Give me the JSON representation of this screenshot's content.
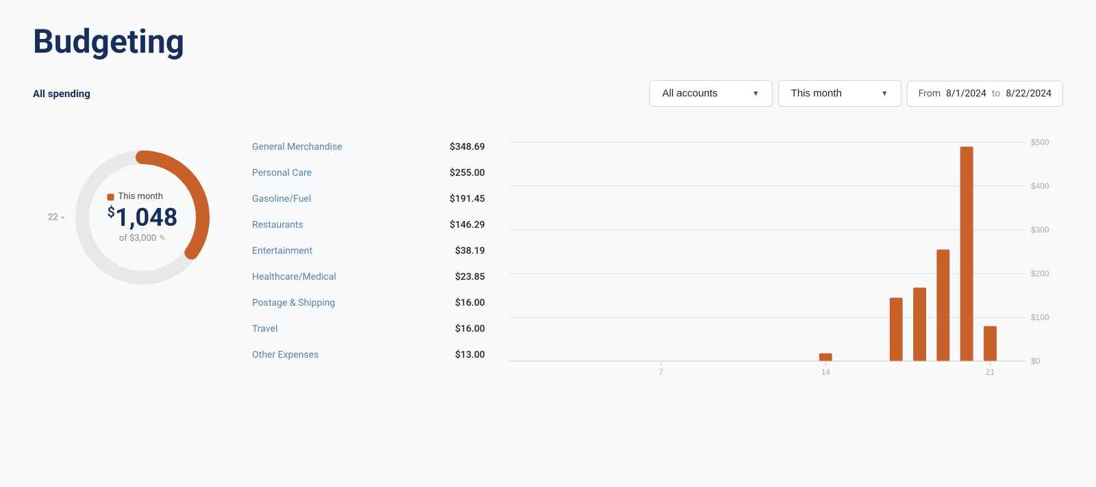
{
  "page": {
    "title": "Budgeting"
  },
  "controls": {
    "all_spending_label": "All spending",
    "accounts_dropdown_label": "All accounts",
    "period_dropdown_label": "This month",
    "from_label": "From",
    "from_date": "8/1/2024",
    "to_label": "to",
    "to_date": "8/22/2024"
  },
  "donut": {
    "legend_label": "This month",
    "amount_symbol": "$",
    "amount": "1,048",
    "of_label": "of $3,000",
    "tick_label": "22",
    "progress_pct": 34.93,
    "color": "#c8602a",
    "track_color": "#e8e8e8"
  },
  "spending_categories": [
    {
      "name": "General Merchandise",
      "amount": "$348.69"
    },
    {
      "name": "Personal Care",
      "amount": "$255.00"
    },
    {
      "name": "Gasoline/Fuel",
      "amount": "$191.45"
    },
    {
      "name": "Restaurants",
      "amount": "$146.29"
    },
    {
      "name": "Entertainment",
      "amount": "$38.19"
    },
    {
      "name": "Healthcare/Medical",
      "amount": "$23.85"
    },
    {
      "name": "Postage & Shipping",
      "amount": "$16.00"
    },
    {
      "name": "Travel",
      "amount": "$16.00"
    },
    {
      "name": "Other Expenses",
      "amount": "$13.00"
    }
  ],
  "bar_chart": {
    "y_labels": [
      "$500",
      "$400",
      "$300",
      "$200",
      "$100",
      "$0"
    ],
    "x_labels": [
      "7",
      "14",
      "21"
    ],
    "bars": [
      {
        "day": 1,
        "value": 0
      },
      {
        "day": 2,
        "value": 0
      },
      {
        "day": 3,
        "value": 0
      },
      {
        "day": 4,
        "value": 0
      },
      {
        "day": 5,
        "value": 0
      },
      {
        "day": 6,
        "value": 0
      },
      {
        "day": 7,
        "value": 0
      },
      {
        "day": 8,
        "value": 0
      },
      {
        "day": 9,
        "value": 0
      },
      {
        "day": 10,
        "value": 0
      },
      {
        "day": 11,
        "value": 0
      },
      {
        "day": 12,
        "value": 0
      },
      {
        "day": 13,
        "value": 0
      },
      {
        "day": 14,
        "value": 18
      },
      {
        "day": 15,
        "value": 0
      },
      {
        "day": 16,
        "value": 0
      },
      {
        "day": 17,
        "value": 145
      },
      {
        "day": 18,
        "value": 168
      },
      {
        "day": 19,
        "value": 255
      },
      {
        "day": 20,
        "value": 490
      },
      {
        "day": 21,
        "value": 80
      },
      {
        "day": 22,
        "value": 0
      }
    ],
    "max_value": 500,
    "color": "#c8602a"
  }
}
